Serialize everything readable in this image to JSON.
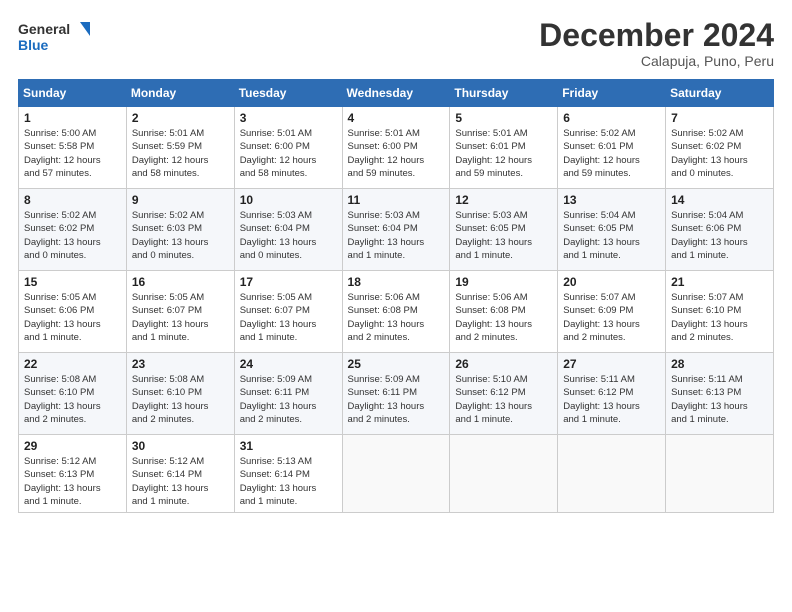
{
  "header": {
    "logo_line1": "General",
    "logo_line2": "Blue",
    "month": "December 2024",
    "location": "Calapuja, Puno, Peru"
  },
  "weekdays": [
    "Sunday",
    "Monday",
    "Tuesday",
    "Wednesday",
    "Thursday",
    "Friday",
    "Saturday"
  ],
  "weeks": [
    [
      {
        "day": "1",
        "info": "Sunrise: 5:00 AM\nSunset: 5:58 PM\nDaylight: 12 hours\nand 57 minutes."
      },
      {
        "day": "2",
        "info": "Sunrise: 5:01 AM\nSunset: 5:59 PM\nDaylight: 12 hours\nand 58 minutes."
      },
      {
        "day": "3",
        "info": "Sunrise: 5:01 AM\nSunset: 6:00 PM\nDaylight: 12 hours\nand 58 minutes."
      },
      {
        "day": "4",
        "info": "Sunrise: 5:01 AM\nSunset: 6:00 PM\nDaylight: 12 hours\nand 59 minutes."
      },
      {
        "day": "5",
        "info": "Sunrise: 5:01 AM\nSunset: 6:01 PM\nDaylight: 12 hours\nand 59 minutes."
      },
      {
        "day": "6",
        "info": "Sunrise: 5:02 AM\nSunset: 6:01 PM\nDaylight: 12 hours\nand 59 minutes."
      },
      {
        "day": "7",
        "info": "Sunrise: 5:02 AM\nSunset: 6:02 PM\nDaylight: 13 hours\nand 0 minutes."
      }
    ],
    [
      {
        "day": "8",
        "info": "Sunrise: 5:02 AM\nSunset: 6:02 PM\nDaylight: 13 hours\nand 0 minutes."
      },
      {
        "day": "9",
        "info": "Sunrise: 5:02 AM\nSunset: 6:03 PM\nDaylight: 13 hours\nand 0 minutes."
      },
      {
        "day": "10",
        "info": "Sunrise: 5:03 AM\nSunset: 6:04 PM\nDaylight: 13 hours\nand 0 minutes."
      },
      {
        "day": "11",
        "info": "Sunrise: 5:03 AM\nSunset: 6:04 PM\nDaylight: 13 hours\nand 1 minute."
      },
      {
        "day": "12",
        "info": "Sunrise: 5:03 AM\nSunset: 6:05 PM\nDaylight: 13 hours\nand 1 minute."
      },
      {
        "day": "13",
        "info": "Sunrise: 5:04 AM\nSunset: 6:05 PM\nDaylight: 13 hours\nand 1 minute."
      },
      {
        "day": "14",
        "info": "Sunrise: 5:04 AM\nSunset: 6:06 PM\nDaylight: 13 hours\nand 1 minute."
      }
    ],
    [
      {
        "day": "15",
        "info": "Sunrise: 5:05 AM\nSunset: 6:06 PM\nDaylight: 13 hours\nand 1 minute."
      },
      {
        "day": "16",
        "info": "Sunrise: 5:05 AM\nSunset: 6:07 PM\nDaylight: 13 hours\nand 1 minute."
      },
      {
        "day": "17",
        "info": "Sunrise: 5:05 AM\nSunset: 6:07 PM\nDaylight: 13 hours\nand 1 minute."
      },
      {
        "day": "18",
        "info": "Sunrise: 5:06 AM\nSunset: 6:08 PM\nDaylight: 13 hours\nand 2 minutes."
      },
      {
        "day": "19",
        "info": "Sunrise: 5:06 AM\nSunset: 6:08 PM\nDaylight: 13 hours\nand 2 minutes."
      },
      {
        "day": "20",
        "info": "Sunrise: 5:07 AM\nSunset: 6:09 PM\nDaylight: 13 hours\nand 2 minutes."
      },
      {
        "day": "21",
        "info": "Sunrise: 5:07 AM\nSunset: 6:10 PM\nDaylight: 13 hours\nand 2 minutes."
      }
    ],
    [
      {
        "day": "22",
        "info": "Sunrise: 5:08 AM\nSunset: 6:10 PM\nDaylight: 13 hours\nand 2 minutes."
      },
      {
        "day": "23",
        "info": "Sunrise: 5:08 AM\nSunset: 6:10 PM\nDaylight: 13 hours\nand 2 minutes."
      },
      {
        "day": "24",
        "info": "Sunrise: 5:09 AM\nSunset: 6:11 PM\nDaylight: 13 hours\nand 2 minutes."
      },
      {
        "day": "25",
        "info": "Sunrise: 5:09 AM\nSunset: 6:11 PM\nDaylight: 13 hours\nand 2 minutes."
      },
      {
        "day": "26",
        "info": "Sunrise: 5:10 AM\nSunset: 6:12 PM\nDaylight: 13 hours\nand 1 minute."
      },
      {
        "day": "27",
        "info": "Sunrise: 5:11 AM\nSunset: 6:12 PM\nDaylight: 13 hours\nand 1 minute."
      },
      {
        "day": "28",
        "info": "Sunrise: 5:11 AM\nSunset: 6:13 PM\nDaylight: 13 hours\nand 1 minute."
      }
    ],
    [
      {
        "day": "29",
        "info": "Sunrise: 5:12 AM\nSunset: 6:13 PM\nDaylight: 13 hours\nand 1 minute."
      },
      {
        "day": "30",
        "info": "Sunrise: 5:12 AM\nSunset: 6:14 PM\nDaylight: 13 hours\nand 1 minute."
      },
      {
        "day": "31",
        "info": "Sunrise: 5:13 AM\nSunset: 6:14 PM\nDaylight: 13 hours\nand 1 minute."
      },
      null,
      null,
      null,
      null
    ]
  ]
}
